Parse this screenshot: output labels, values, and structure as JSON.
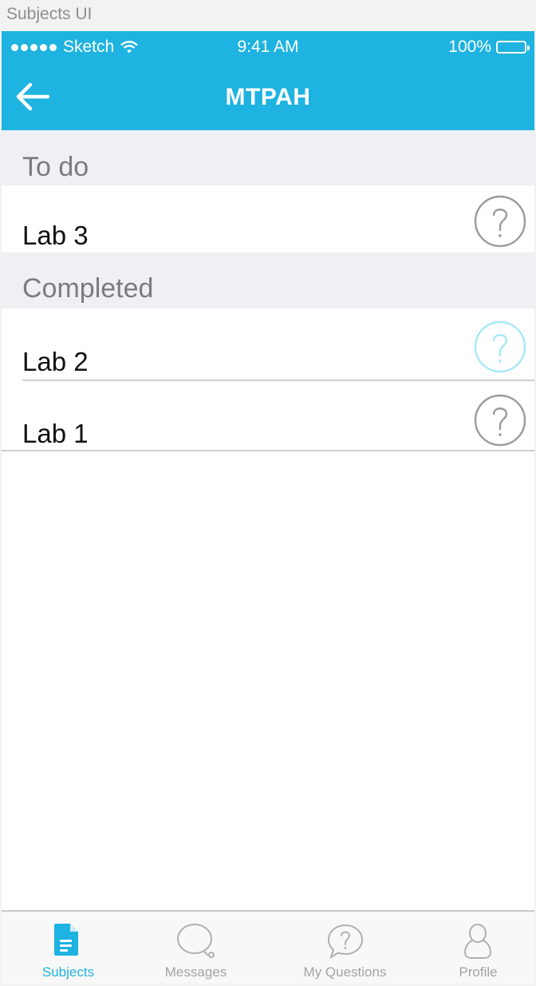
{
  "artboard": {
    "label": "Subjects UI"
  },
  "status_bar": {
    "carrier": "Sketch",
    "time": "9:41 AM",
    "battery": "100%"
  },
  "nav": {
    "title": "MTPAH"
  },
  "sections": {
    "todo": {
      "header": "To do",
      "items": [
        {
          "label": "Lab 3"
        }
      ]
    },
    "completed": {
      "header": "Completed",
      "items": [
        {
          "label": "Lab 2"
        },
        {
          "label": "Lab 1"
        }
      ]
    }
  },
  "tabs": [
    {
      "label": "Subjects",
      "active": true
    },
    {
      "label": "Messages"
    },
    {
      "label": "My Questions"
    },
    {
      "label": "Profile"
    }
  ],
  "colors": {
    "accent": "#1eb3e0",
    "help_active": "#a6e8f8",
    "help_default": "#9b9b9b"
  },
  "icons": {
    "back": "arrow-left-icon",
    "help": "question-circle-icon",
    "subjects": "document-icon",
    "messages": "chat-bubble-icon",
    "questions": "question-bubble-icon",
    "profile": "person-icon"
  }
}
